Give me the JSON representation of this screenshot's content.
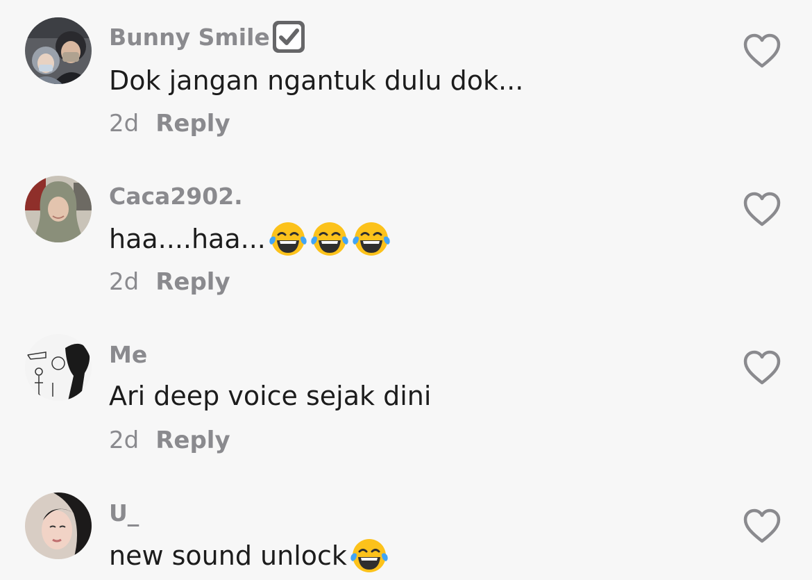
{
  "comments": [
    {
      "username": "Bunny Smile",
      "verified": true,
      "text": "Dok jangan ngantuk dulu dok...",
      "emoji_count": 0,
      "time": "2d",
      "reply_label": "Reply"
    },
    {
      "username": "Caca2902.",
      "verified": false,
      "text": "haa....haa...",
      "emoji_count": 3,
      "time": "2d",
      "reply_label": "Reply"
    },
    {
      "username": "Me",
      "verified": false,
      "text": "Ari deep voice sejak dini",
      "emoji_count": 0,
      "time": "2d",
      "reply_label": "Reply"
    },
    {
      "username": "U_",
      "verified": false,
      "text": "new sound unlock",
      "emoji_count": 1,
      "time": "",
      "reply_label": ""
    }
  ],
  "icons": {
    "like": "heart-outline-icon",
    "verified": "checkbox-check-icon",
    "emoji": "face-with-tears-of-joy-emoji"
  },
  "colors": {
    "background": "#f7f7f7",
    "username": "#8a8a8e",
    "text": "#1c1c1c",
    "icon": "#8a8a8e"
  }
}
